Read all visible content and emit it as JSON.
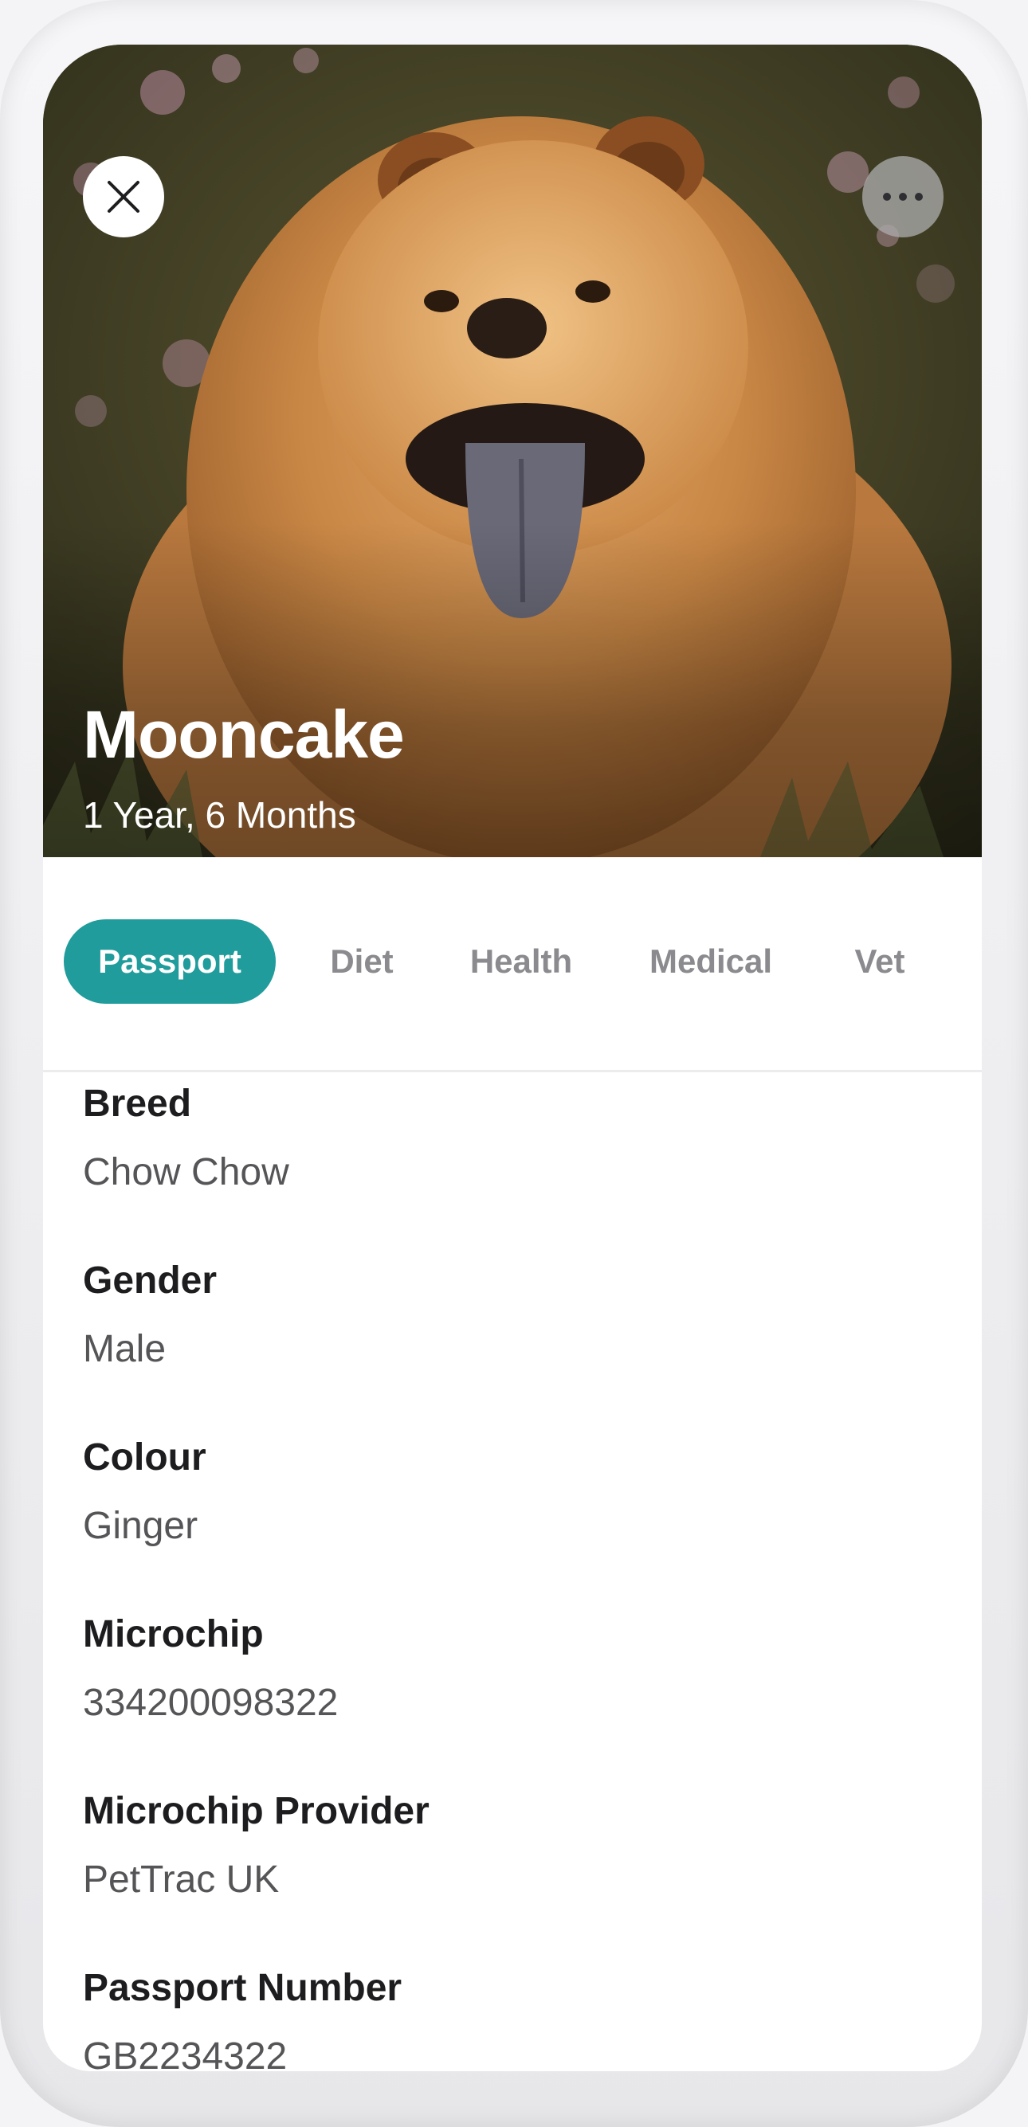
{
  "pet": {
    "name": "Mooncake",
    "age": "1 Year, 6 Months",
    "photo_icon": "dog-photo"
  },
  "header": {
    "close_icon": "close-icon",
    "more_icon": "more-horizontal-icon"
  },
  "tabs": [
    {
      "label": "Passport",
      "active": true
    },
    {
      "label": "Diet",
      "active": false
    },
    {
      "label": "Health",
      "active": false
    },
    {
      "label": "Medical",
      "active": false
    },
    {
      "label": "Vet",
      "active": false
    }
  ],
  "fields": [
    {
      "label": "Breed",
      "value": "Chow Chow"
    },
    {
      "label": "Gender",
      "value": "Male"
    },
    {
      "label": "Colour",
      "value": "Ginger"
    },
    {
      "label": "Microchip",
      "value": "334200098322"
    },
    {
      "label": "Microchip Provider",
      "value": "PetTrac UK"
    },
    {
      "label": "Passport Number",
      "value": "GB2234322"
    }
  ],
  "colors": {
    "accent": "#1f9c9b",
    "label": "#1d1d1f",
    "value": "#555558",
    "inactive_tab": "#8b8b8f"
  }
}
